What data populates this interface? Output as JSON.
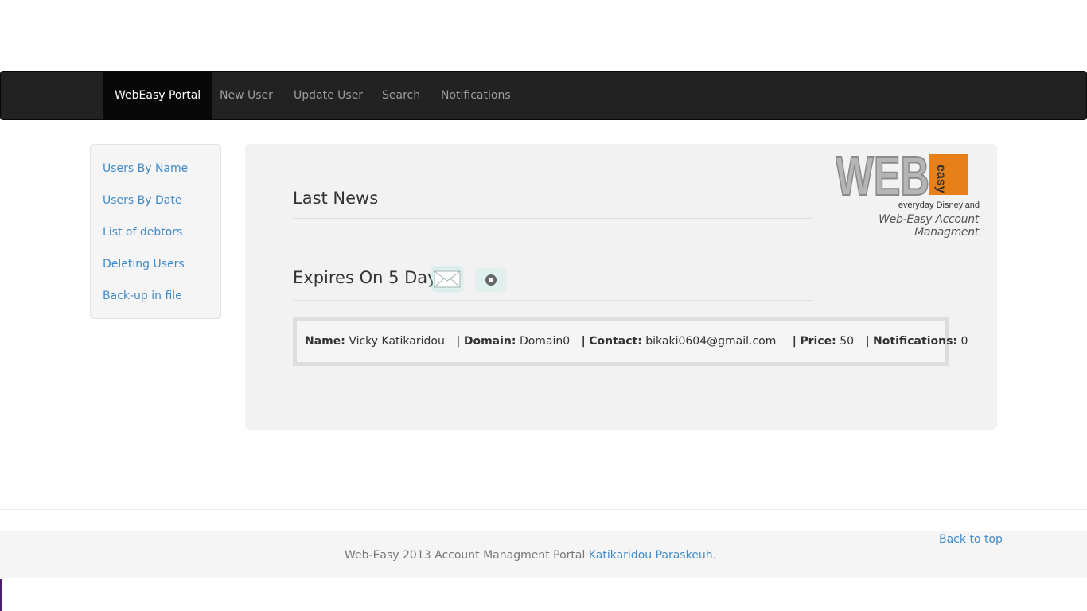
{
  "navbar": {
    "brand": "WebEasy Portal",
    "links": [
      {
        "label": "New User"
      },
      {
        "label": "Update User"
      },
      {
        "label": "Search"
      },
      {
        "label": "Notifications"
      }
    ]
  },
  "sidebar": {
    "items": [
      {
        "label": "Users By Name"
      },
      {
        "label": "Users By Date"
      },
      {
        "label": "List of debtors"
      },
      {
        "label": "Deleting Users"
      },
      {
        "label": "Back-up in file"
      }
    ]
  },
  "logo": {
    "letters": "WEB",
    "side_text": "easy",
    "slogan": "everyday Disneyland",
    "tagline": "Web-Easy Account Managment"
  },
  "main": {
    "news_heading": "Last News",
    "expires_heading": "Expires On 5 Days",
    "mail_icon": "envelope-icon",
    "close_icon": "close-circle-icon"
  },
  "record": {
    "name_label": "Name:",
    "name_value": "Vicky Katikaridou",
    "domain_label": "Domain:",
    "domain_value": "Domain0",
    "contact_label": "Contact:",
    "contact_value": "bikaki0604@gmail.com",
    "price_label": "Price:",
    "price_value": "50",
    "notifications_label": "Notifications:",
    "notifications_value": "0",
    "separator": "|"
  },
  "footer": {
    "back_to_top": "Back to top",
    "text": "Web-Easy 2013 Account Managment Portal",
    "author_link": "Katikaridou Paraskeuh",
    "end": "."
  },
  "colors": {
    "navbar_bg": "#222222",
    "link": "#428bca",
    "logo_orange": "#e8801a",
    "logo_gray": "#9a9a9a"
  }
}
